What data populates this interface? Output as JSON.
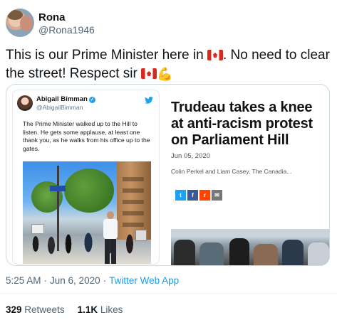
{
  "author": {
    "name": "Rona",
    "handle": "@Rona1946"
  },
  "tweet": {
    "text_part1": "This is our Prime Minister here in ",
    "text_part2": ". No need to clear the street! Respect sir ",
    "emoji_flag": "canada-flag",
    "emoji_muscle": "flexed-biceps"
  },
  "embedded_tweet": {
    "name": "Abigail Bimman",
    "handle": "@AbigailBimman",
    "text": "The Prime Minister walked up to the Hill to listen. He gets some applause, at least one thank you, as he walks from his office up to the gates."
  },
  "article": {
    "title": "Trudeau takes a knee at anti-racism protest on Parliament Hill",
    "date": "Jun 05, 2020",
    "authors": "Colin Perkel and Liam Casey, The Canadia..."
  },
  "share_buttons": [
    {
      "label": "t",
      "icon": "twitter-icon"
    },
    {
      "label": "f",
      "icon": "facebook-icon"
    },
    {
      "label": "r",
      "icon": "reddit-icon"
    },
    {
      "label": "✉",
      "icon": "email-icon"
    }
  ],
  "meta": {
    "time": "5:25 AM",
    "separator": "·",
    "date": "Jun 6, 2020",
    "app": "Twitter Web App"
  },
  "stats": {
    "retweets_count": "329",
    "retweets_label": "Retweets",
    "likes_count": "1.1K",
    "likes_label": "Likes"
  },
  "colors": {
    "link": "#1d9bf0",
    "muted": "#536471",
    "text": "#0f1419"
  }
}
